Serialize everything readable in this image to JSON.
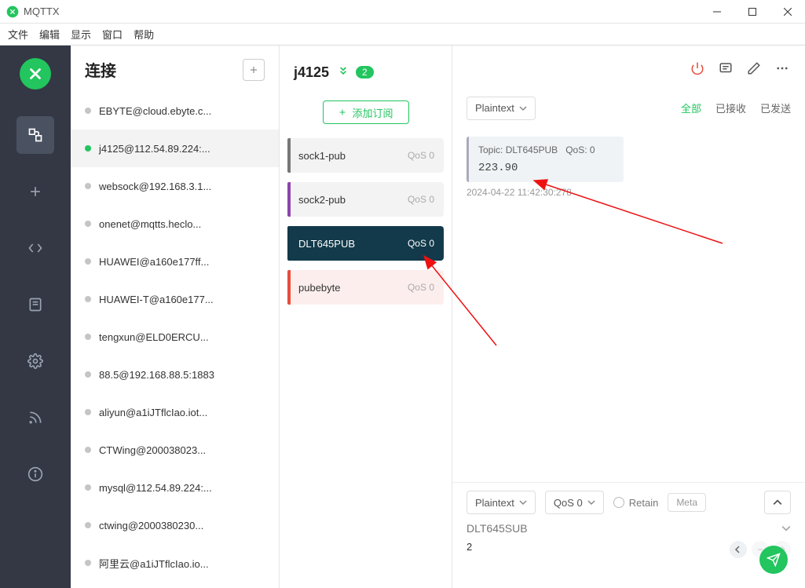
{
  "app": {
    "title": "MQTTX"
  },
  "menu": {
    "items": [
      "文件",
      "编辑",
      "显示",
      "窗口",
      "帮助"
    ]
  },
  "rail_icons": [
    "connections-icon",
    "plus-icon",
    "code-icon",
    "script-icon",
    "settings-icon",
    "rss-icon",
    "info-icon"
  ],
  "connections": {
    "title": "连接",
    "items": [
      {
        "label": "EBYTE@cloud.ebyte.c...",
        "status": "grey"
      },
      {
        "label": "j4125@112.54.89.224:...",
        "status": "green",
        "active": true
      },
      {
        "label": "websock@192.168.3.1...",
        "status": "grey"
      },
      {
        "label": "onenet@mqtts.heclo...",
        "status": "grey"
      },
      {
        "label": "HUAWEI@a160e177ff...",
        "status": "grey"
      },
      {
        "label": "HUAWEI-T@a160e177...",
        "status": "grey"
      },
      {
        "label": "tengxun@ELD0ERCU...",
        "status": "grey"
      },
      {
        "label": "88.5@192.168.88.5:1883",
        "status": "grey"
      },
      {
        "label": "aliyun@a1iJTflcIao.iot...",
        "status": "grey"
      },
      {
        "label": "CTWing@200038023...",
        "status": "grey"
      },
      {
        "label": "mysql@112.54.89.224:...",
        "status": "grey"
      },
      {
        "label": "ctwing@2000380230...",
        "status": "grey"
      },
      {
        "label": "阿里云@a1iJTflcIao.io...",
        "status": "grey"
      }
    ]
  },
  "subs": {
    "conn_name": "j4125",
    "badge": "2",
    "add_label": "添加订阅",
    "items": [
      {
        "name": "sock1-pub",
        "qos": "QoS 0",
        "color": "#777"
      },
      {
        "name": "sock2-pub",
        "qos": "QoS 0",
        "color": "#8e44ad"
      },
      {
        "name": "DLT645PUB",
        "qos": "QoS 0",
        "color": "#123a4a",
        "selected": true
      },
      {
        "name": "pubebyte",
        "qos": "QoS 0",
        "color": "#e74c3c",
        "pink": true
      }
    ]
  },
  "content": {
    "format": "Plaintext",
    "filters": {
      "all": "全部",
      "received": "已接收",
      "sent": "已发送"
    },
    "message": {
      "topic_prefix": "Topic: ",
      "topic": "DLT645PUB",
      "qos_prefix": "QoS: ",
      "qos": "0",
      "value": "223.90",
      "time": "2024-04-22 11:42:30:278"
    }
  },
  "publish": {
    "format": "Plaintext",
    "qos": "QoS 0",
    "retain": "Retain",
    "meta": "Meta",
    "topic": "DLT645SUB",
    "body": "2"
  }
}
